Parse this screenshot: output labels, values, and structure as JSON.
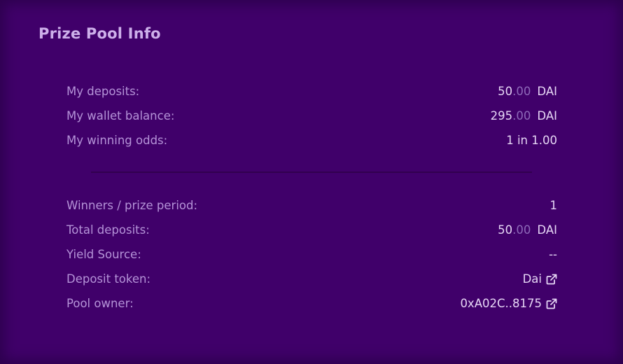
{
  "card": {
    "title": "Prize Pool Info"
  },
  "user_stats": {
    "deposits": {
      "label": "My deposits:",
      "whole": "50",
      "decimal": ".00",
      "unit": "DAI"
    },
    "wallet_balance": {
      "label": "My wallet balance:",
      "whole": "295",
      "decimal": ".00",
      "unit": "DAI"
    },
    "winning_odds": {
      "label": "My winning odds:",
      "value": "1 in 1.00"
    }
  },
  "pool_stats": {
    "winners": {
      "label": "Winners / prize period:",
      "value": "1"
    },
    "total_deposits": {
      "label": "Total deposits:",
      "whole": "50",
      "decimal": ".00",
      "unit": "DAI"
    },
    "yield_source": {
      "label": "Yield Source:",
      "value": "--"
    },
    "deposit_token": {
      "label": "Deposit token:",
      "value": "Dai",
      "icon": "external-link-icon"
    },
    "pool_owner": {
      "label": "Pool owner:",
      "value": "0xA02C..8175",
      "icon": "external-link-icon"
    }
  },
  "colors": {
    "background": "#40006a",
    "title": "#cdb0ea",
    "label": "#b593d8",
    "value": "#e6d6f5",
    "decimal": "#8d68b8"
  }
}
